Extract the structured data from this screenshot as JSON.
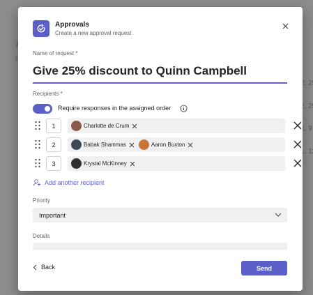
{
  "background": {
    "title": "A",
    "subtitle": "R",
    "cells": [
      "2, 25",
      "2, 25",
      "2, 9",
      "1, 12"
    ]
  },
  "dialog": {
    "app_name": "Approvals",
    "app_subtitle": "Create a new approval request",
    "close_icon": "close-icon",
    "name_label": "Name of request",
    "required_mark": "*",
    "name_value": "Give 25% discount to Quinn Campbell",
    "recipients_label": "Recipients",
    "toggle_label": "Require responses in the assigned order",
    "toggle_on": true,
    "recipients": [
      {
        "order": "1",
        "people": [
          {
            "name": "Charlotte de Crum",
            "avatar_color": "#8a5a4a"
          }
        ]
      },
      {
        "order": "2",
        "people": [
          {
            "name": "Babak Shammas",
            "avatar_color": "#3d4a55"
          },
          {
            "name": "Aaron Buxton",
            "avatar_color": "#c8743a"
          }
        ]
      },
      {
        "order": "3",
        "people": [
          {
            "name": "Krystal McKinney",
            "avatar_color": "#2f2f2f"
          }
        ]
      }
    ],
    "add_recipient_label": "Add another recipient",
    "priority_label": "Priority",
    "priority_value": "Important",
    "details_label": "Details",
    "back_label": "Back",
    "send_label": "Send",
    "accent_color": "#5b5fc7"
  }
}
